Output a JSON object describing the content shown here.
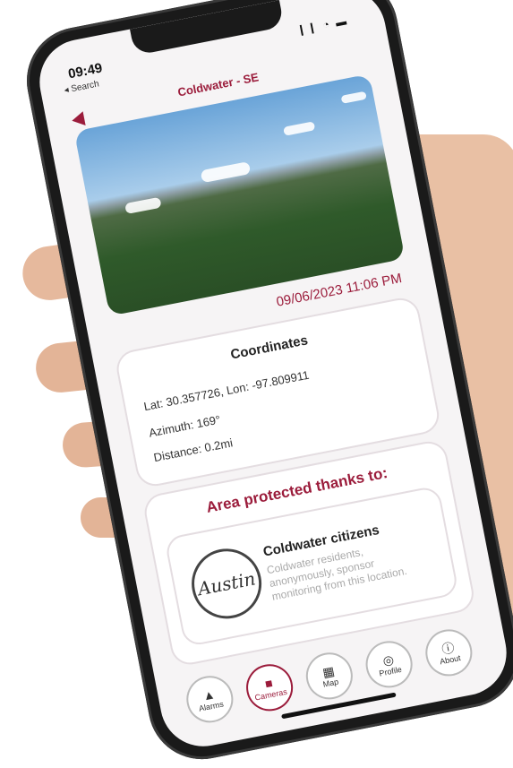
{
  "status_bar": {
    "time": "09:49",
    "back_app": "◂ Search",
    "icons": "❙❙ ◔ ▬"
  },
  "header": {
    "title": "Coldwater - SE"
  },
  "feed": {
    "datetime": "09/06/2023 11:06 PM"
  },
  "coordinates": {
    "heading": "Coordinates",
    "latlon": "Lat: 30.357726, Lon: -97.809911",
    "azimuth": "Azimuth: 169°",
    "distance": "Distance: 0.2mi"
  },
  "sponsor": {
    "heading": "Area protected thanks to:",
    "name": "Coldwater citizens",
    "description": "Coldwater residents, anonymously, sponsor monitoring from this location.",
    "seal_text": "Austin"
  },
  "nav": {
    "items": [
      {
        "label": "Alarms",
        "icon": "bell-icon",
        "glyph": "▲"
      },
      {
        "label": "Cameras",
        "icon": "camera-icon",
        "glyph": "■"
      },
      {
        "label": "Map",
        "icon": "map-icon",
        "glyph": "▦"
      },
      {
        "label": "Profile",
        "icon": "profile-icon",
        "glyph": "◎"
      },
      {
        "label": "About",
        "icon": "info-icon",
        "glyph": "ⓘ"
      }
    ],
    "active": "Cameras"
  },
  "colors": {
    "accent": "#9b1c3b",
    "card_border": "#e4dde1"
  }
}
